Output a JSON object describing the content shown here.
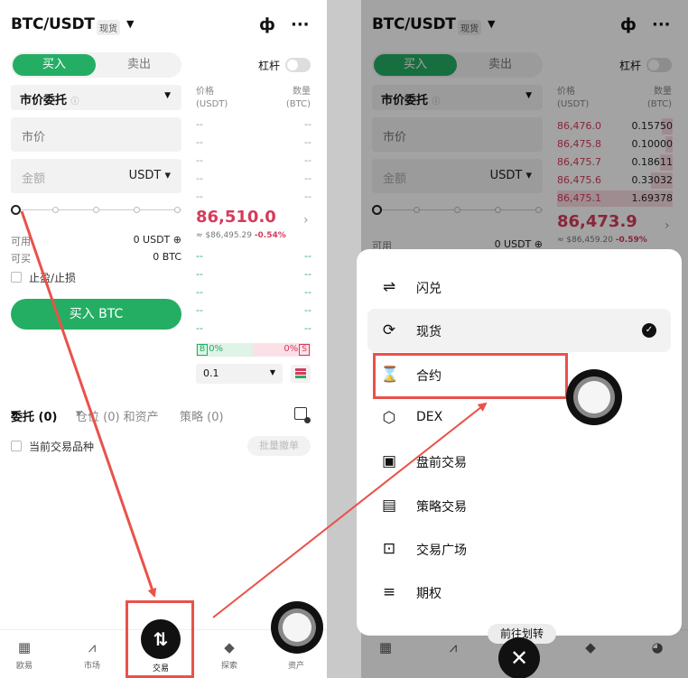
{
  "header": {
    "pair": "BTC/USDT",
    "market_badge": "现货"
  },
  "order_form": {
    "buy_tab": "买入",
    "sell_tab": "卖出",
    "leverage_label": "杠杆",
    "order_type": "市价委托",
    "price_placeholder": "市价",
    "amount_placeholder": "金额",
    "amount_unit": "USDT",
    "available_label": "可用",
    "available_value": "0 USDT",
    "can_buy_label": "可买",
    "can_buy_value": "0 BTC",
    "tp_sl_label": "止盈/止损",
    "submit_label": "买入 BTC"
  },
  "orderbook_left": {
    "price_header": "价格",
    "price_unit": "(USDT)",
    "qty_header": "数量",
    "qty_unit": "(BTC)",
    "empty_mark": "--",
    "last_price": "86,510.0",
    "last_usd": "≈ $86,495.29",
    "last_change": "-0.54%",
    "buy_ratio": "0%",
    "sell_ratio": "0%",
    "buy_tag": "B",
    "sell_tag": "S",
    "precision": "0.1"
  },
  "orderbook_right": {
    "asks": [
      {
        "price": "86,476.0",
        "qty": "0.15750",
        "depth": 0.09
      },
      {
        "price": "86,475.8",
        "qty": "0.10000",
        "depth": 0.06
      },
      {
        "price": "86,475.7",
        "qty": "0.18611",
        "depth": 0.11
      },
      {
        "price": "86,475.6",
        "qty": "0.33032",
        "depth": 0.19
      },
      {
        "price": "86,475.1",
        "qty": "1.69378",
        "depth": 1.0
      }
    ],
    "last_price": "86,473.9",
    "last_usd": "≈ $86,459.20",
    "last_change": "-0.59%"
  },
  "orders_panel": {
    "tab_orders": "委托 (0)",
    "tab_positions": "仓位 (0) 和资产",
    "tab_strategy": "策略 (0)",
    "current_only": "当前交易品种",
    "cancel_all": "批量撤单"
  },
  "bottom_nav": [
    {
      "label": "欧易",
      "icon": "okx-logo-icon"
    },
    {
      "label": "市场",
      "icon": "market-chart-icon"
    },
    {
      "label": "交易",
      "icon": "trade-icon"
    },
    {
      "label": "探索",
      "icon": "explore-icon"
    },
    {
      "label": "资产",
      "icon": "assets-icon"
    }
  ],
  "trade_menu": {
    "items": [
      {
        "label": "闪兑",
        "icon": "swap-icon"
      },
      {
        "label": "现货",
        "icon": "spot-icon",
        "selected": true
      },
      {
        "label": "合约",
        "icon": "futures-icon"
      },
      {
        "label": "DEX",
        "icon": "dex-icon"
      },
      {
        "label": "盘前交易",
        "icon": "pre-market-icon"
      },
      {
        "label": "策略交易",
        "icon": "strategy-icon"
      },
      {
        "label": "交易广场",
        "icon": "trade-square-icon"
      },
      {
        "label": "期权",
        "icon": "options-icon"
      }
    ],
    "goto_label": "前往划转"
  },
  "colors": {
    "buy_green": "#24ae64",
    "sell_red": "#d53b5c",
    "annotation_red": "#e9524a"
  }
}
